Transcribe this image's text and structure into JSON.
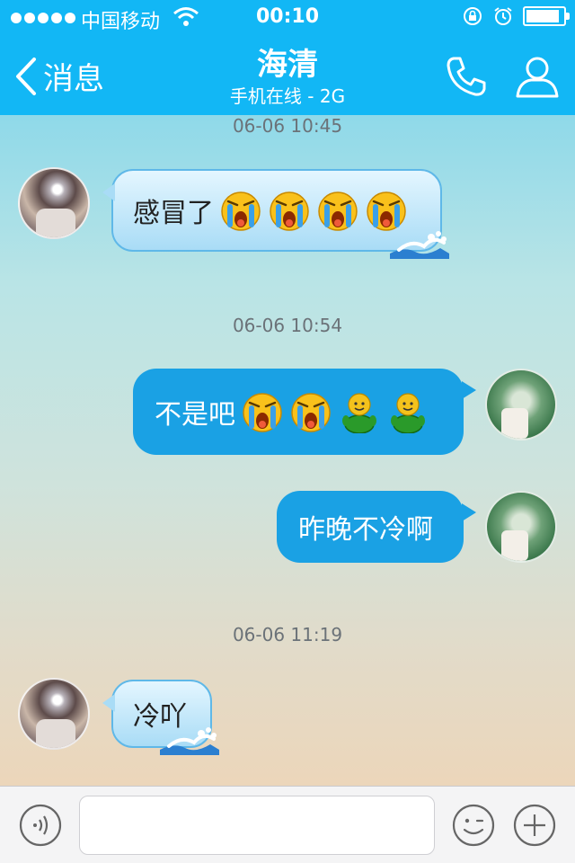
{
  "status_bar": {
    "carrier": "中国移动",
    "time": "00:10",
    "signal_icon": "signal-dots-icon",
    "wifi_icon": "wifi-icon",
    "lock_icon": "rotation-lock-icon",
    "alarm_icon": "alarm-icon",
    "battery_icon": "battery-icon"
  },
  "nav": {
    "back_label": "消息",
    "title": "海清",
    "subtitle": "手机在线 - 2G",
    "call_icon": "phone-icon",
    "profile_icon": "profile-icon"
  },
  "chat": {
    "timestamps": [
      "06-06 10:45",
      "06-06 10:54",
      "06-06 11:19"
    ],
    "messages": [
      {
        "from": "contact",
        "text": "感冒了",
        "emojis": [
          "crying-face",
          "crying-face",
          "crying-face",
          "crying-face"
        ]
      },
      {
        "from": "me",
        "text": "不是吧",
        "emojis": [
          "crying-face",
          "crying-face",
          "green-qq-figure",
          "green-qq-figure"
        ]
      },
      {
        "from": "me",
        "text": "昨晚不冷啊",
        "emojis": []
      },
      {
        "from": "contact",
        "text": "冷吖",
        "emojis": []
      }
    ]
  },
  "input": {
    "placeholder": "",
    "voice_icon": "voice-icon",
    "emoji_icon": "emoji-icon",
    "plus_icon": "plus-icon"
  },
  "colors": {
    "header": "#12b7f5",
    "outgoing_bubble": "#1aa1e4",
    "incoming_bubble": "#a9dcf6"
  }
}
